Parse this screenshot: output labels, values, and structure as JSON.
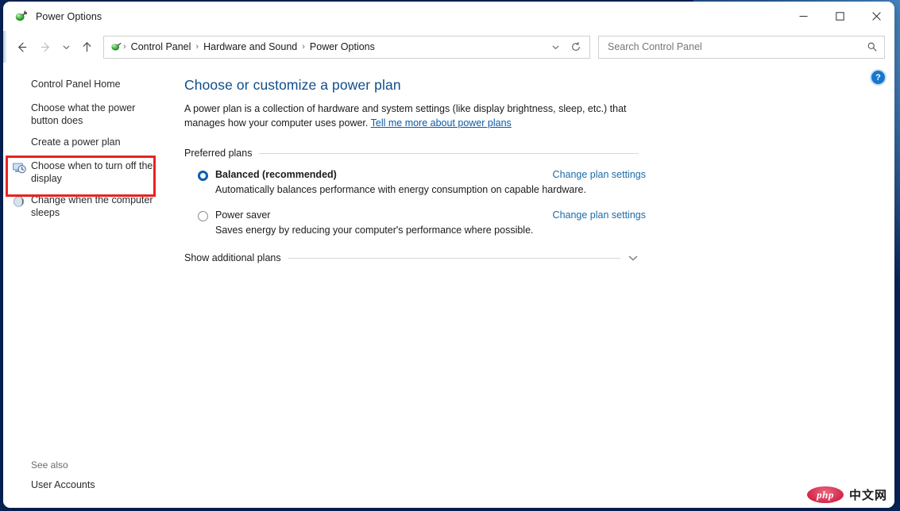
{
  "window": {
    "title": "Power Options",
    "icon": "power-plug-icon",
    "minimize_label": "—",
    "maximize_label": "□",
    "close_label": "✕"
  },
  "nav": {
    "back_label": "←",
    "forward_label": "→",
    "recent_label": "⌄",
    "up_label": "↑",
    "refresh_label": "↻",
    "dropdown_label": "⌄"
  },
  "breadcrumb": {
    "icon": "power-plug-icon",
    "items": [
      "Control Panel",
      "Hardware and Sound",
      "Power Options"
    ],
    "separator": "›"
  },
  "search": {
    "placeholder": "Search Control Panel",
    "value": "",
    "icon": "search-icon"
  },
  "sidebar": {
    "items": [
      {
        "label": "Control Panel Home",
        "icon": ""
      },
      {
        "label": "Choose what the power button does",
        "icon": ""
      },
      {
        "label": "Create a power plan",
        "icon": ""
      },
      {
        "label": "Choose when to turn off the display",
        "icon": "display-clock-icon"
      },
      {
        "label": "Change when the computer sleeps",
        "icon": "sleep-moon-icon"
      }
    ],
    "see_also_label": "See also",
    "see_also_link": "User Accounts"
  },
  "main": {
    "help_label": "?",
    "title": "Choose or customize a power plan",
    "intro_text": "A power plan is a collection of hardware and system settings (like display brightness, sleep, etc.) that manages how your computer uses power. ",
    "intro_link": "Tell me more about power plans",
    "preferred_plans_label": "Preferred plans",
    "plans": [
      {
        "name": "Balanced (recommended)",
        "description": "Automatically balances performance with energy consumption on capable hardware.",
        "selected": true,
        "link": "Change plan settings"
      },
      {
        "name": "Power saver",
        "description": "Saves energy by reducing your computer's performance where possible.",
        "selected": false,
        "link": "Change plan settings"
      }
    ],
    "show_additional_label": "Show additional plans",
    "show_additional_icon": "chevron-down-icon"
  },
  "annotation": {
    "highlight_target": "Change when the computer sleeps",
    "color": "#e8231f"
  },
  "watermark": {
    "brand": "php",
    "suffix": "中文网"
  }
}
